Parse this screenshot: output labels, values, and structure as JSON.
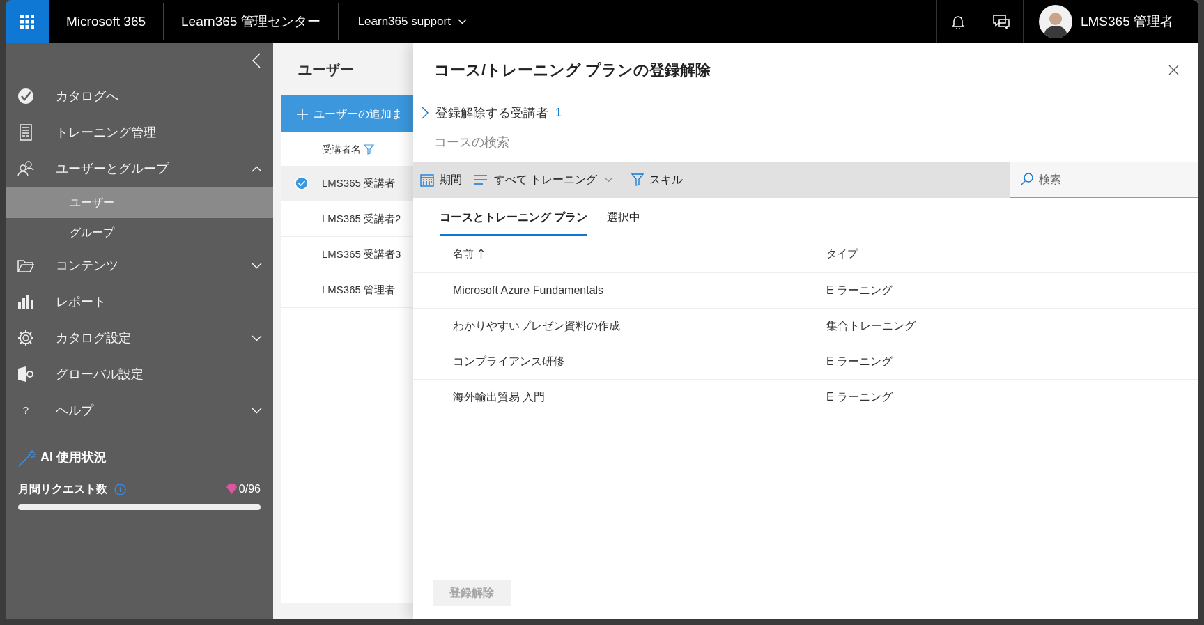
{
  "top_bar": {
    "product": "Microsoft 365",
    "app": "Learn365 管理センター",
    "tenant": "Learn365 support",
    "user": "LMS365 管理者"
  },
  "sidebar": {
    "items": [
      {
        "label": "カタログへ",
        "selected": false
      },
      {
        "label": "トレーニング管理",
        "selected": false
      },
      {
        "label": "ユーザーとグループ",
        "selected": false,
        "expanded": true,
        "children": [
          {
            "label": "ユーザー",
            "selected": true
          },
          {
            "label": "グループ",
            "selected": false
          }
        ]
      },
      {
        "label": "コンテンツ",
        "selected": false,
        "expanded": false
      },
      {
        "label": "レポート",
        "selected": false
      },
      {
        "label": "カタログ設定",
        "selected": false,
        "expanded": false
      },
      {
        "label": "グローバル設定",
        "selected": false
      },
      {
        "label": "ヘルプ",
        "selected": false,
        "expanded": false
      }
    ],
    "help_glyph": "?",
    "ai_usage": {
      "title": "AI 使用状況",
      "label": "月間リクエスト数",
      "count": "0/96",
      "level": 0
    }
  },
  "users": {
    "title": "ユーザー",
    "add_button": "ユーザーの追加ま",
    "column": "受講者名",
    "rows": [
      {
        "name": "LMS365 受講者",
        "selected": true
      },
      {
        "name": "LMS365 受講者2",
        "selected": false
      },
      {
        "name": "LMS365 受講者3",
        "selected": false
      },
      {
        "name": "LMS365 管理者",
        "selected": false
      }
    ]
  },
  "panel": {
    "title": "コース/トレーニング プランの登録解除",
    "recipients_label": "登録解除する受講者",
    "recipients_count": "1",
    "search_label": "コースの検索",
    "toolbar": {
      "period": "期間",
      "type_filter": "すべて トレーニング",
      "skills": "スキル",
      "search_placeholder": "検索"
    },
    "tabs": [
      {
        "label": "コースとトレーニング プラン",
        "selected": true
      },
      {
        "label": "選択中",
        "selected": false
      }
    ],
    "columns": [
      "名前",
      "タイプ"
    ],
    "rows": [
      {
        "name": "Microsoft Azure Fundamentals",
        "type": "E ラーニング"
      },
      {
        "name": "わかりやすいプレゼン資料の作成",
        "type": "集合トレーニング"
      },
      {
        "name": "コンプライアンス研修",
        "type": "E ラーニング"
      },
      {
        "name": "海外輸出貿易 入門",
        "type": "E ラーニング"
      }
    ],
    "button": {
      "label": "登録解除",
      "disabled": true
    }
  }
}
